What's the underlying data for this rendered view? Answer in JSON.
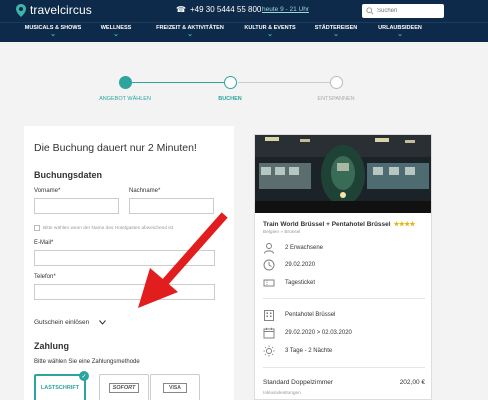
{
  "header": {
    "logo_text": "travelcircus",
    "phone": "+49 30 5444 55 800",
    "hours": "heute 9 - 21 Uhr",
    "search_placeholder": "Suchen"
  },
  "nav": [
    "MUSICALS & SHOWS",
    "WELLNESS",
    "FREIZEIT & AKTIVITÄTEN",
    "KULTUR & EVENTS",
    "STÄDTEREISEN",
    "URLAUBSIDEEN"
  ],
  "progress": {
    "steps": [
      {
        "label": "ANGEBOT WÄHLEN",
        "state": "done"
      },
      {
        "label": "BUCHEN",
        "state": "active"
      },
      {
        "label": "ENTSPANNEN",
        "state": "pending"
      }
    ],
    "colors": {
      "accent": "#2ba59e",
      "inactive": "#bbbbbb"
    }
  },
  "form": {
    "title": "Die Buchung dauert nur 2 Minuten!",
    "section_booking": "Buchungsdaten",
    "firstname_label": "Vorname*",
    "lastname_label": "Nachname*",
    "checkbox_label": "Bitte wählen wenn der Name des Hotelgastes abweichend ist",
    "email_label": "E-Mail*",
    "phone_label": "Telefon*",
    "voucher_label": "Gutschein einlösen",
    "section_payment": "Zahlung",
    "payment_hint": "Bitte wählen Sie eine Zahlungsmethode",
    "payment_options": [
      "LASTSCHRIFT",
      "SOFORT",
      "VISA"
    ]
  },
  "card": {
    "title": "Train World Brüssel + Pentahotel Brüssel",
    "stars": "★★★★",
    "location": "Belgien » Brüssel",
    "guests": "2 Erwachsene",
    "date": "29.02.2020",
    "ticket": "Tagesticket",
    "hotel": "Pentahotel Brüssel",
    "stay": "29.02.2020 > 02.03.2020",
    "nights": "3 Tage - 2 Nächte",
    "room": "Standard Doppelzimmer",
    "price": "202,00 €",
    "includes": "Inklusivleistungen"
  }
}
